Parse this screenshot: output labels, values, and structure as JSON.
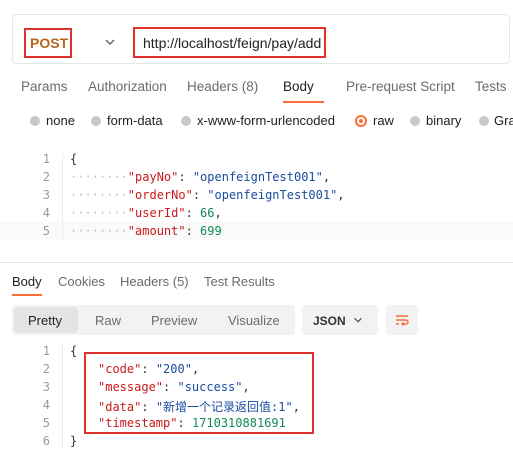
{
  "request": {
    "method": "POST",
    "url": "http://localhost/feign/pay/add"
  },
  "request_tabs": {
    "params": "Params",
    "authorization": "Authorization",
    "headers": "Headers (8)",
    "body": "Body",
    "pre_request": "Pre-request Script",
    "tests": "Tests"
  },
  "body_modes": {
    "none": "none",
    "form_data": "form-data",
    "urlencoded": "x-www-form-urlencoded",
    "raw": "raw",
    "binary": "binary",
    "graphql": "Gra"
  },
  "request_body": {
    "line_numbers": [
      "1",
      "2",
      "3",
      "4",
      "5"
    ],
    "open": "{",
    "lines": [
      {
        "key": "\"payNo\"",
        "value": "\"openfeignTest001\"",
        "type": "str",
        "comma": ","
      },
      {
        "key": "\"orderNo\"",
        "value": "\"openfeignTest001\"",
        "type": "str",
        "comma": ","
      },
      {
        "key": "\"userId\"",
        "value": "66",
        "type": "num",
        "comma": ","
      },
      {
        "key": "\"amount\"",
        "value": "699",
        "type": "num",
        "comma": ""
      }
    ]
  },
  "response_tabs": {
    "body": "Body",
    "cookies": "Cookies",
    "headers": "Headers (5)",
    "test_results": "Test Results"
  },
  "view_modes": {
    "pretty": "Pretty",
    "raw": "Raw",
    "preview": "Preview",
    "visualize": "Visualize"
  },
  "format": "JSON",
  "response_body": {
    "line_numbers": [
      "1",
      "2",
      "3",
      "4",
      "5",
      "6"
    ],
    "open": "{",
    "close": "}",
    "lines": [
      {
        "key": "\"code\"",
        "value": "\"200\"",
        "type": "str",
        "comma": ","
      },
      {
        "key": "\"message\"",
        "value": "\"success\"",
        "type": "str",
        "comma": ","
      },
      {
        "key": "\"data\"",
        "value": "\"新增一个记录返回值:1\"",
        "type": "str",
        "comma": ","
      },
      {
        "key": "\"timestamp\"",
        "value": "1710310881691",
        "type": "num",
        "comma": ""
      }
    ]
  },
  "colors": {
    "accent": "#ff6c37",
    "highlight": "#e0312c",
    "method": "#b5651d",
    "key": "#c91a1a",
    "string": "#1a4ca0",
    "number": "#118a55"
  }
}
